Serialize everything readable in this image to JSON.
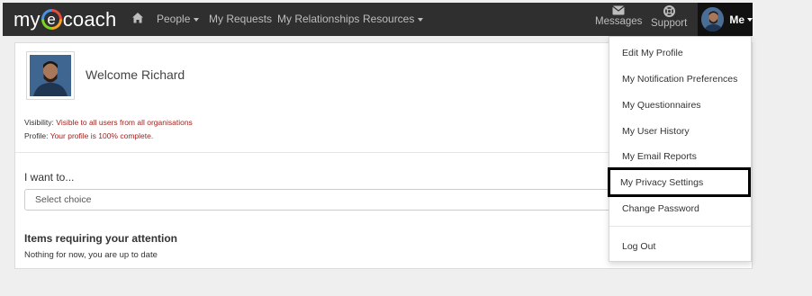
{
  "navbar": {
    "logo_left": "my",
    "logo_e": "e",
    "logo_right": "coach",
    "links": {
      "people": "People",
      "requests": "My Requests",
      "relationships": "My Relationships",
      "resources": "Resources"
    },
    "messages": "Messages",
    "support": "Support",
    "me": "Me"
  },
  "welcome": {
    "greeting": "Welcome Richard",
    "visibility_label": "Visibility:",
    "visibility_value": "Visible to all users from all organisations",
    "profile_label": "Profile:",
    "profile_value": "Your profile is 100% complete."
  },
  "i_want": {
    "title": "I want to...",
    "select_placeholder": "Select choice"
  },
  "attention": {
    "title": "Items requiring your attention",
    "note": "Nothing for now, you are up to date"
  },
  "me_menu": {
    "items": [
      "Edit My Profile",
      "My Notification Preferences",
      "My Questionnaires",
      "My User History",
      "My Email Reports",
      "My Privacy Settings",
      "Change Password"
    ],
    "logout": "Log Out",
    "highlighted": "My Privacy Settings"
  },
  "colors": {
    "navbar": "#2f2f2f",
    "accent_red": "#a0231f"
  }
}
